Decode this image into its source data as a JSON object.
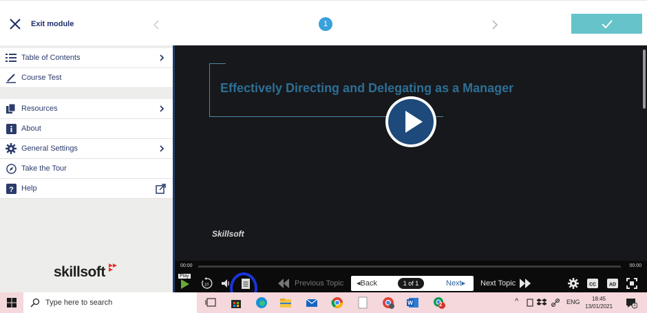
{
  "topbar": {
    "exit_label": "Exit module",
    "page_number": "1"
  },
  "sidebar": {
    "items": [
      {
        "label": "Table of Contents",
        "icon": "list-icon",
        "has_chevron": true
      },
      {
        "label": "Course Test",
        "icon": "pencil-icon",
        "has_chevron": false
      },
      {
        "label": "Resources",
        "icon": "documents-icon",
        "has_chevron": true
      },
      {
        "label": "About",
        "icon": "info-icon",
        "has_chevron": false
      },
      {
        "label": "General Settings",
        "icon": "gear-icon",
        "has_chevron": true
      },
      {
        "label": "Take the Tour",
        "icon": "compass-icon",
        "has_chevron": false
      },
      {
        "label": "Help",
        "icon": "question-icon",
        "has_chevron": false
      }
    ],
    "logo": "skillsoft"
  },
  "video": {
    "title": "Effectively Directing and Delegating as a Manager",
    "watermark": "Skillsoft"
  },
  "controls": {
    "time_elapsed": "00:00",
    "time_total": "00:00",
    "play_tooltip": "Play",
    "previous_topic": "Previous Topic",
    "back": "Back",
    "page_indicator": "1 of 1",
    "next": "Next",
    "next_topic": "Next Topic"
  },
  "taskbar": {
    "search_placeholder": "Type here to search",
    "language": "ENG",
    "time": "18:45",
    "date": "13/01/2021",
    "notification_count": "1",
    "badge_count": "2"
  },
  "colors": {
    "accent": "#66c3c9",
    "navy": "#1d2b6b",
    "video_bg": "#17181b",
    "title": "#2d6f95",
    "highlight": "#1a35d8",
    "taskbar": "#f4d8dc"
  }
}
